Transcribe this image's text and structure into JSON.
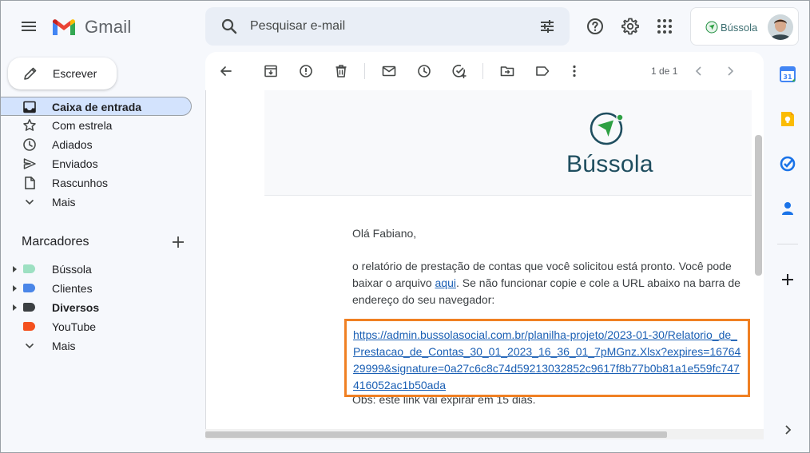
{
  "header": {
    "app_name": "Gmail",
    "search_placeholder": "Pesquisar e-mail",
    "account_brand": "Bússola"
  },
  "sidebar": {
    "compose_label": "Escrever",
    "items": [
      {
        "label": "Caixa de entrada",
        "icon": "inbox-icon",
        "active": true
      },
      {
        "label": "Com estrela",
        "icon": "star-icon"
      },
      {
        "label": "Adiados",
        "icon": "clock-icon"
      },
      {
        "label": "Enviados",
        "icon": "send-icon"
      },
      {
        "label": "Rascunhos",
        "icon": "draft-icon"
      },
      {
        "label": "Mais",
        "icon": "chevron-down-icon"
      }
    ],
    "labels_title": "Marcadores",
    "labels": [
      {
        "label": "Bússola",
        "color": "#9de0c2",
        "bold": false
      },
      {
        "label": "Clientes",
        "color": "#4a86e8",
        "bold": false
      },
      {
        "label": "Diversos",
        "color": "#3c4043",
        "bold": true
      },
      {
        "label": "YouTube",
        "color": "#f4511e",
        "bold": false
      }
    ],
    "labels_more": "Mais"
  },
  "toolbar": {
    "pager": "1 de 1"
  },
  "email": {
    "brand_name": "Bússola",
    "greeting": "Olá Fabiano,",
    "body_before_link": "o relatório de prestação de contas que você solicitou está pronto. Você pode baixar o arquivo ",
    "link_text": "aqui",
    "body_after_link": ". Se não funcionar copie e cole a URL abaixo na barra de endereço do seu navegador:",
    "url": "https://admin.bussolasocial.com.br/planilha-projeto/2023-01-30/Relatorio_de_Prestacao_de_Contas_30_01_2023_16_36_01_7pMGnz.Xlsx?expires=1676429999&signature=0a27c6c8c74d59213032852c9617f8b77b0b81a1e559fc747416052ac1b50ada",
    "footnote": "Obs: este link vai expirar em 15 dias."
  },
  "colors": {
    "highlight_border": "#f08023",
    "link": "#1a5fb4",
    "active_nav": "#d3e3fd"
  }
}
